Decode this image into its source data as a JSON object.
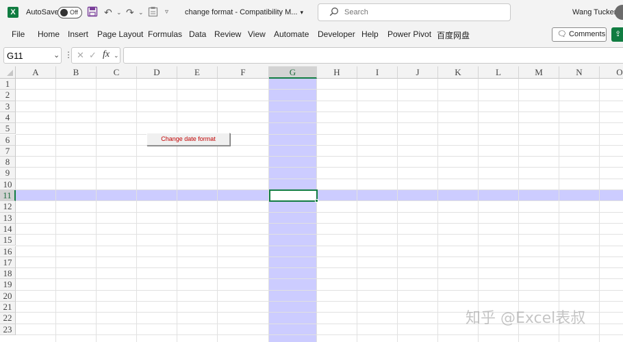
{
  "title_bar": {
    "app_icon_letter": "X",
    "autosave_label": "AutoSave",
    "autosave_state": "Off",
    "document_title": "change format  -  Compatibility M...",
    "search_placeholder": "Search",
    "user_name": "Wang Tucker"
  },
  "ribbon": {
    "tabs": [
      "File",
      "Home",
      "Insert",
      "Page Layout",
      "Formulas",
      "Data",
      "Review",
      "View",
      "Automate",
      "Developer",
      "Help",
      "Power Pivot",
      "百度网盘"
    ],
    "comments_label": "Comments"
  },
  "formula_bar": {
    "name_box": "G11",
    "fx_label": "fx",
    "formula": ""
  },
  "grid": {
    "columns": [
      "A",
      "B",
      "C",
      "D",
      "E",
      "F",
      "G",
      "H",
      "I",
      "J",
      "K",
      "L",
      "M",
      "N",
      "O"
    ],
    "rows": [
      "1",
      "2",
      "3",
      "4",
      "5",
      "6",
      "7",
      "8",
      "9",
      "10",
      "11",
      "12",
      "13",
      "14",
      "15",
      "16",
      "17",
      "18",
      "19",
      "20",
      "21",
      "22",
      "23"
    ],
    "selected_column": "G",
    "selected_row": "11",
    "highlight_color": "#ccccff"
  },
  "form_button": {
    "label": "Change date format"
  },
  "watermark": "知乎 @Excel表叔"
}
